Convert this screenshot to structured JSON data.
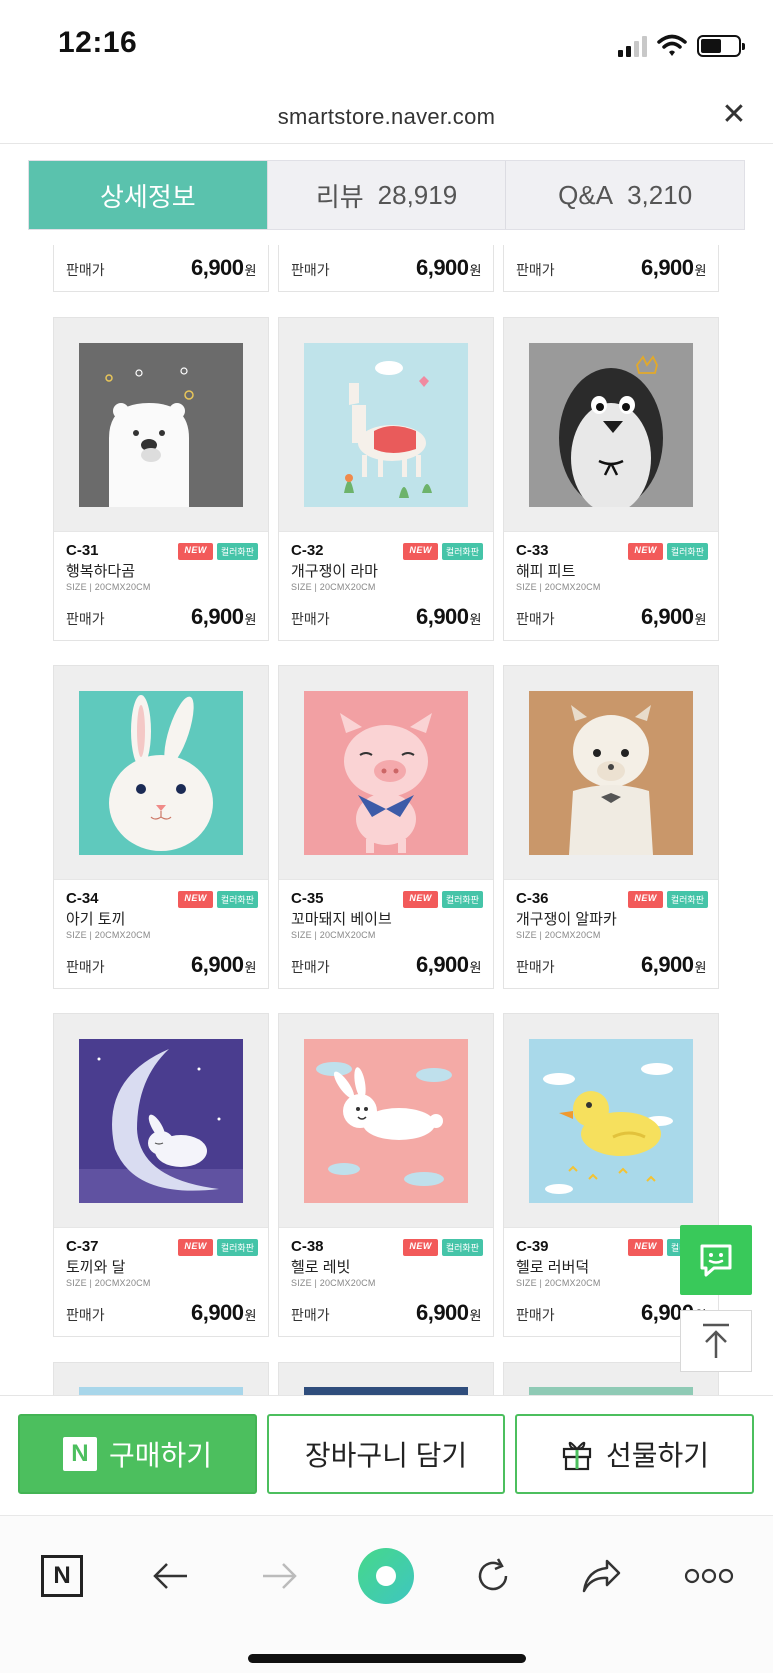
{
  "status": {
    "time": "12:16"
  },
  "url_bar": {
    "url": "smartstore.naver.com",
    "close_icon": "close-icon"
  },
  "tabs": [
    {
      "label": "상세정보",
      "count": "",
      "active": true
    },
    {
      "label": "리뷰",
      "count": "28,919",
      "active": false
    },
    {
      "label": "Q&A",
      "count": "3,210",
      "active": false
    }
  ],
  "top_row": [
    {
      "price_label": "판매가",
      "price": "6,900",
      "currency": "원"
    },
    {
      "price_label": "판매가",
      "price": "6,900",
      "currency": "원"
    },
    {
      "price_label": "판매가",
      "price": "6,900",
      "currency": "원"
    }
  ],
  "products": [
    {
      "code": "C-31",
      "name": "행복하다곰",
      "size": "SIZE | 20CMX20CM",
      "badge_new": "NEW",
      "badge_color": "컬러화판",
      "price_label": "판매가",
      "price": "6,900",
      "currency": "원",
      "bg": "#6b6b6b",
      "art": "polar-bear"
    },
    {
      "code": "C-32",
      "name": "개구쟁이 라마",
      "size": "SIZE | 20CMX20CM",
      "badge_new": "NEW",
      "badge_color": "컬러화판",
      "price_label": "판매가",
      "price": "6,900",
      "currency": "원",
      "bg": "#bfe3ea",
      "art": "llama"
    },
    {
      "code": "C-33",
      "name": "해피 피트",
      "size": "SIZE | 20CMX20CM",
      "badge_new": "NEW",
      "badge_color": "컬러화판",
      "price_label": "판매가",
      "price": "6,900",
      "currency": "원",
      "bg": "#9a9a9a",
      "art": "penguin"
    },
    {
      "code": "C-34",
      "name": "아기 토끼",
      "size": "SIZE | 20CMX20CM",
      "badge_new": "NEW",
      "badge_color": "컬러화판",
      "price_label": "판매가",
      "price": "6,900",
      "currency": "원",
      "bg": "#5fc9bd",
      "art": "rabbit"
    },
    {
      "code": "C-35",
      "name": "꼬마돼지 베이브",
      "size": "SIZE | 20CMX20CM",
      "badge_new": "NEW",
      "badge_color": "컬러화판",
      "price_label": "판매가",
      "price": "6,900",
      "currency": "원",
      "bg": "#f2a0a3",
      "art": "pig"
    },
    {
      "code": "C-36",
      "name": "개구쟁이 알파카",
      "size": "SIZE | 20CMX20CM",
      "badge_new": "NEW",
      "badge_color": "컬러화판",
      "price_label": "판매가",
      "price": "6,900",
      "currency": "원",
      "bg": "#c9976a",
      "art": "alpaca"
    },
    {
      "code": "C-37",
      "name": "토끼와 달",
      "size": "SIZE | 20CMX20CM",
      "badge_new": "NEW",
      "badge_color": "컬러화판",
      "price_label": "판매가",
      "price": "6,900",
      "currency": "원",
      "bg": "#4a3d8f",
      "art": "moon-rabbit"
    },
    {
      "code": "C-38",
      "name": "헬로 레빗",
      "size": "SIZE | 20CMX20CM",
      "badge_new": "NEW",
      "badge_color": "컬러화판",
      "price_label": "판매가",
      "price": "6,900",
      "currency": "원",
      "bg": "#f4aaa6",
      "art": "jumping-rabbit"
    },
    {
      "code": "C-39",
      "name": "헬로 러버덕",
      "size": "SIZE | 20CMX20CM",
      "badge_new": "NEW",
      "badge_color": "컬러화판",
      "price_label": "판매가",
      "price": "6,900",
      "currency": "원",
      "bg": "#a9d9ea",
      "art": "rubber-duck"
    }
  ],
  "peek_colors": [
    "#a8d6ea",
    "#2f4d7c",
    "#8fcab5"
  ],
  "floating": {
    "chat_icon": "chat-icon",
    "top_icon": "scroll-top-icon"
  },
  "purchase": {
    "buy": "구매하기",
    "buy_logo": "N",
    "cart": "장바구니 담기",
    "gift": "선물하기"
  },
  "browser": {
    "home_logo": "N",
    "icons": [
      "naver-home-icon",
      "back-arrow-icon",
      "forward-arrow-icon",
      "green-dot-icon",
      "reload-icon",
      "share-icon",
      "more-icon"
    ]
  },
  "colors": {
    "accent": "#5ac2ad",
    "buy_green": "#4cbf5e",
    "new_badge": "#f25a5a",
    "color_badge": "#45c4a8"
  }
}
